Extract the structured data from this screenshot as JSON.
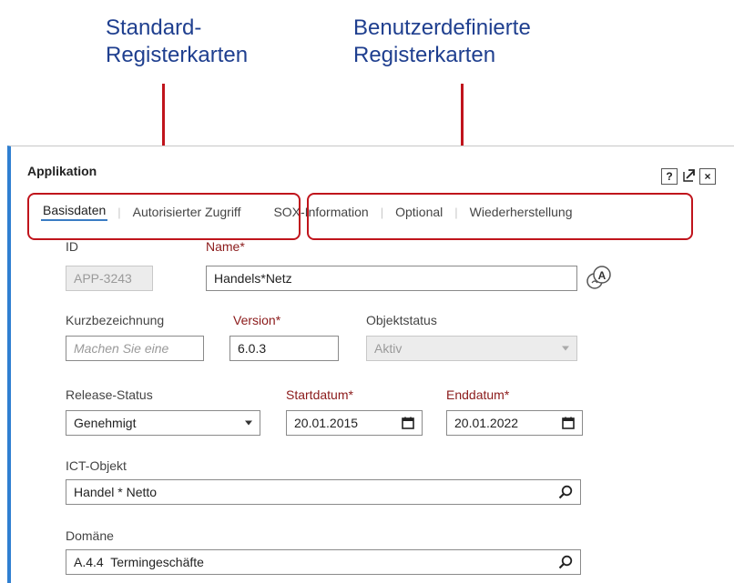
{
  "annotations": {
    "standard_tabs_line1": "Standard-",
    "standard_tabs_line2": "Registerkarten",
    "custom_tabs_line1": "Benutzerdefinierte",
    "custom_tabs_line2": "Registerkarten"
  },
  "dialog": {
    "title": "Applikation",
    "help_icon_label": "?",
    "close_icon_label": "×"
  },
  "tabs": [
    {
      "label": "Basisdaten",
      "active": true
    },
    {
      "label": "Autorisierter Zugriff"
    },
    {
      "label": "SOX-Information"
    },
    {
      "label": "Optional"
    },
    {
      "label": "Wiederherstellung"
    }
  ],
  "tab_separator": "|",
  "form": {
    "id": {
      "label": "ID",
      "value": "APP-3243"
    },
    "name": {
      "label": "Name*",
      "value": "Handels*Netz"
    },
    "short_name": {
      "label": "Kurzbezeichnung",
      "placeholder": "Machen Sie eine"
    },
    "version": {
      "label": "Version*",
      "value": "6.0.3"
    },
    "object_status": {
      "label": "Objektstatus",
      "value": "Aktiv"
    },
    "release_status": {
      "label": "Release-Status",
      "value": "Genehmigt"
    },
    "start_date": {
      "label": "Startdatum*",
      "value": "20.01.2015"
    },
    "end_date": {
      "label": "Enddatum*",
      "value": "20.01.2022"
    },
    "ict_object": {
      "label": "ICT-Objekt",
      "value": "Handel * Netto"
    },
    "domain": {
      "label": "Domäne",
      "value": "A.4.4  Termingeschäfte"
    }
  },
  "colors": {
    "annotation_text": "#1f3f8f",
    "annotation_red": "#c0141c",
    "required_label": "#8b1a1a",
    "dialog_accent": "#2f7fd1"
  }
}
